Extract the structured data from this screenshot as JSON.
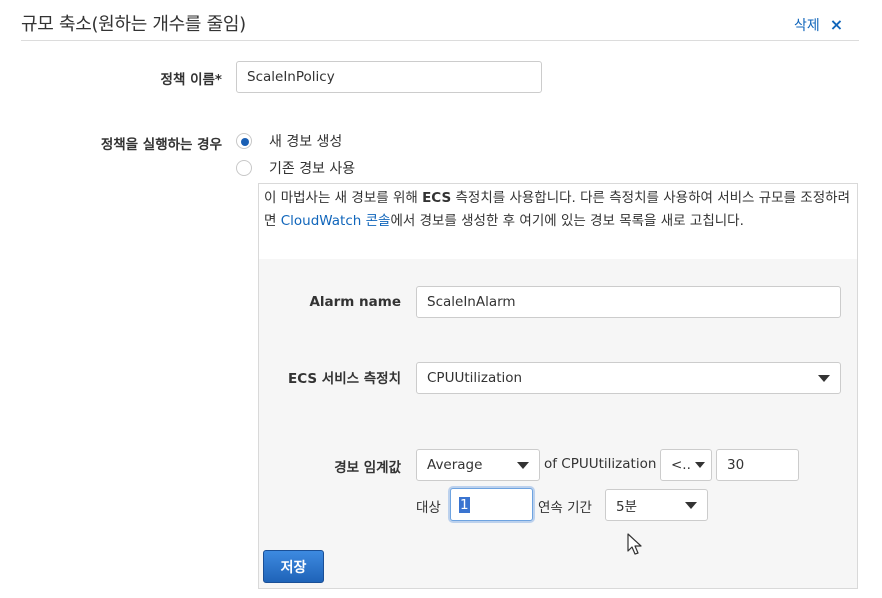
{
  "header": {
    "title": "규모 축소(원하는 개수를 줄임)",
    "delete_label": "삭제",
    "delete_icon": "×"
  },
  "policy": {
    "name_label": "정책 이름*",
    "name_value": "ScaleInPolicy"
  },
  "trigger": {
    "label": "정책을 실행하는 경우",
    "options": [
      {
        "label": "새 경보 생성",
        "checked": true
      },
      {
        "label": "기존 경보 사용",
        "checked": false
      }
    ]
  },
  "note": {
    "text_1": "이 마법사는 새 경보를 위해 ",
    "text_bold": "ECS",
    "text_2": " 측정치를 사용합니다. 다른 측정치를 사용하여 서비스 규모를 조정하려면 ",
    "link": "CloudWatch 콘솔",
    "text_3": "에서 경보를 생성한 후 여기에 있는 경보 목록을 새로 고칩니다."
  },
  "alarm": {
    "name_label": "Alarm name",
    "name_value": "ScaleInAlarm",
    "metric_label": "ECS 서비스 측정치",
    "metric_value": "CPUUtilization",
    "threshold_label": "경보 임계값",
    "statistic_value": "Average",
    "of_text": "of CPUUtilization",
    "operator_value": "<..",
    "threshold_value": "30",
    "for_label": "대상",
    "periods_value": "1",
    "consecutive_label": "연속 기간",
    "period_value": "5분"
  },
  "save_label": "저장",
  "colors": {
    "link": "#1166bb",
    "primary_button": "#1f63b8",
    "radio_checked": "#1a5fb4"
  }
}
